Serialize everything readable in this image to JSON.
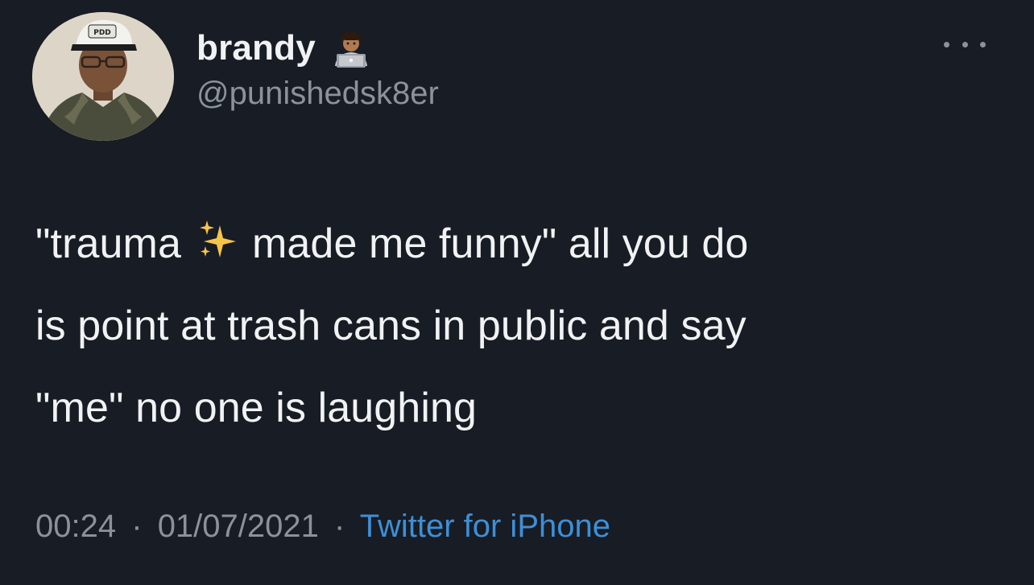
{
  "user": {
    "display_name": "brandy",
    "name_emoji": "technologist-emoji",
    "handle": "@punishedsk8er",
    "avatar_icon": "profile-photo"
  },
  "menu": {
    "icon": "more-options-icon"
  },
  "tweet": {
    "line1_before": "\"trauma",
    "sparkles_icon": "sparkles-emoji",
    "line1_after": "made me funny\" all you do",
    "line2": "is point at trash cans in public and say",
    "line3": "\"me\" no one is laughing"
  },
  "meta": {
    "time": "00:24",
    "date": "01/07/2021",
    "separator": "·",
    "source": "Twitter for iPhone",
    "source_color": "#3e8fd6"
  }
}
